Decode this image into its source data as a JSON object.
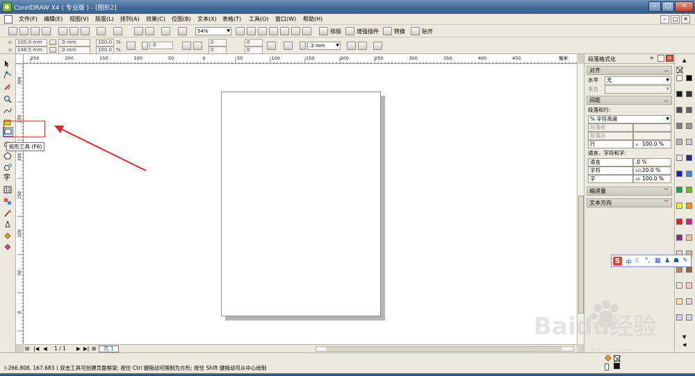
{
  "window": {
    "title": "CorelDRAW X4 ( 专业版 ) - [图形2]",
    "controls": {
      "minimize": "–",
      "maximize": "□",
      "close": "✕"
    }
  },
  "menu": {
    "items": [
      "文件(F)",
      "编辑(E)",
      "视图(V)",
      "版面(L)",
      "排列(A)",
      "效果(C)",
      "位图(B)",
      "文本(X)",
      "表格(T)",
      "工具(O)",
      "窗口(W)",
      "帮助(H)"
    ]
  },
  "toolbar": {
    "zoom_value": "54%",
    "buttons": {
      "typeset": "排版",
      "enhance": "增强插件",
      "convert": "转换",
      "paste": "贴齐"
    }
  },
  "property_bar": {
    "x_label": "x:",
    "x_value": "105.0 mm",
    "y_label": "y:",
    "y_value": "148.5 mm",
    "w_value": ".0 mm",
    "h_value": ".0 mm",
    "scale_x": "100.0",
    "scale_y": "100.0",
    "pct": "%",
    "rotation": ".0",
    "corner_values": [
      "0",
      "0",
      "0",
      "0"
    ],
    "outline_width": ".2 mm"
  },
  "ruler": {
    "h_ticks": [
      "250",
      "200",
      "150",
      "100",
      "50",
      "0",
      "50",
      "100",
      "150",
      "200",
      "250",
      "300",
      "350",
      "400",
      "450"
    ],
    "h_unit": "毫米",
    "v_ticks": [
      "300",
      "250",
      "200",
      "150",
      "100",
      "50",
      "0"
    ]
  },
  "tooltip": {
    "text": "矩形工具 (F6)"
  },
  "page_nav": {
    "count": "1 / 1",
    "tab": "页 1"
  },
  "docker": {
    "title": "段落格式化",
    "sections": {
      "align": "对齐",
      "spacing": "间距",
      "indent": "缩进量",
      "text_direction": "文本方向"
    },
    "align_rows": {
      "horizontal_label": "水平",
      "horizontal_value": "无",
      "vertical_label": "垂直"
    },
    "spacing_rows": {
      "para_line_label": "段落和行:",
      "mode_value": "% 字符高度",
      "before_label": "段落前",
      "after_label": "段落后",
      "line_label": "行",
      "line_value": "100.0 %",
      "lang_label": "语言、字符和字:",
      "language_label": "语言",
      "language_value": ".0 %",
      "char_label": "字符",
      "char_value": "20.0 %",
      "word_label": "字",
      "word_value": "100.0 %"
    }
  },
  "ime_bar": {
    "logo": "S",
    "lang": "中"
  },
  "status": {
    "coords": "(-266.808, 167.683 )",
    "hint": "双击工具可创建页面框架; 按住 Ctrl 键拖动可限制为方形; 按住 Shift 键拖动可从中心绘制"
  },
  "watermark": {
    "brand": "Baidu经验",
    "url": "jingyan.baidu.com"
  },
  "palette_colors": [
    "#ffffff",
    "#000000",
    "#1b1b1b",
    "#333333",
    "#4d4d4d",
    "#666666",
    "#808080",
    "#999999",
    "#b3b3b3",
    "#cccccc",
    "#e6e6e6",
    "#2b2b85",
    "#1c1cc0",
    "#3a8be0",
    "#1aa053",
    "#6bbb1f",
    "#fff200",
    "#f7941d",
    "#ed1c24",
    "#e31a8f",
    "#7e2c8c",
    "#f5c6a4",
    "#f9d0c4",
    "#e0b090",
    "#c08060",
    "#a06040",
    "#f3e6d8",
    "#ffcccc",
    "#ffe0b0",
    "#f0d0e0",
    "#d8c8e8",
    "#c8d8f0"
  ]
}
